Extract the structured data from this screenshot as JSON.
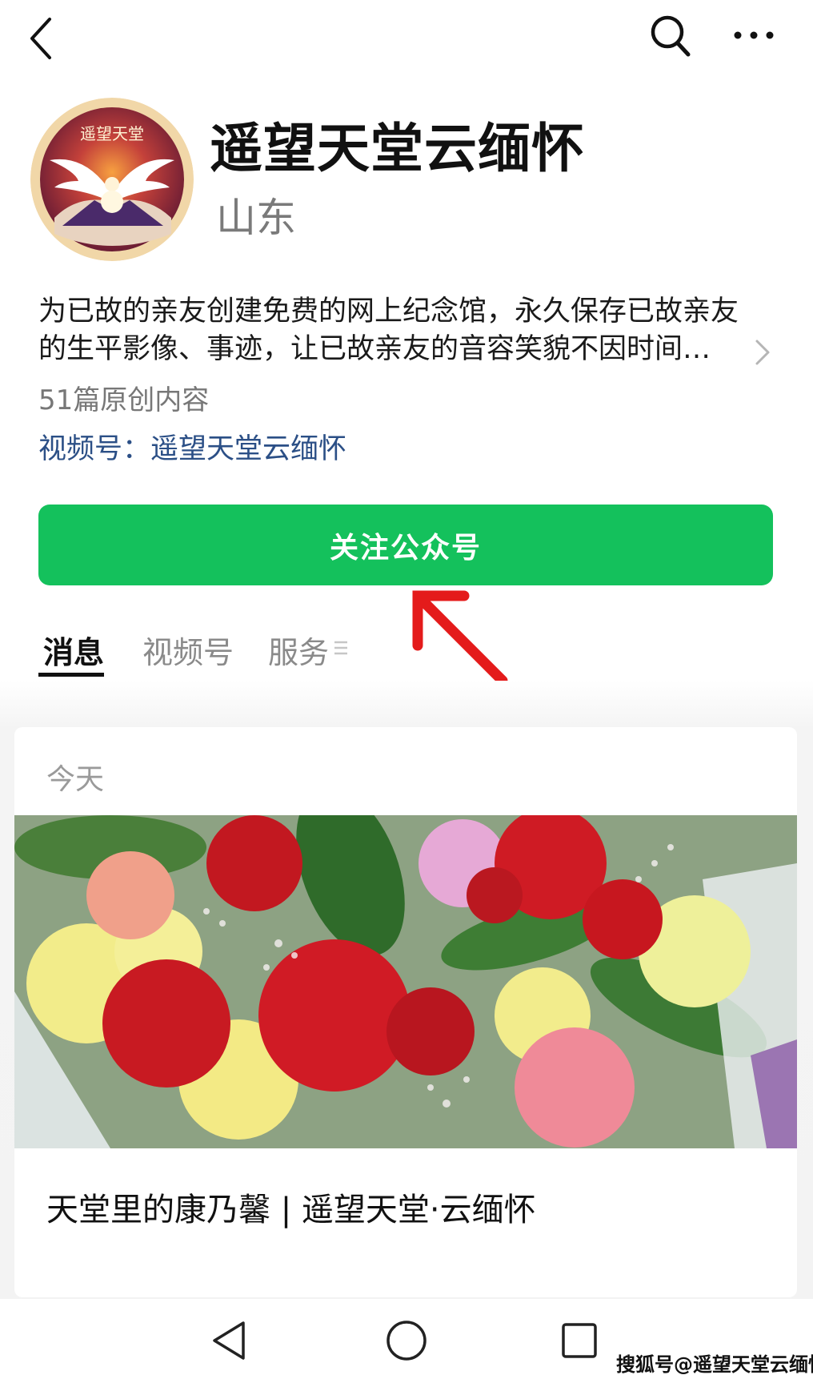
{
  "account": {
    "name": "遥望天堂云缅怀",
    "region": "山东",
    "avatar_text": "遥望天堂",
    "description_line1": "为已故的亲友创建免费的网上纪念馆，永久保存已故亲友",
    "description_line2": "的生平影像、事迹，让已故亲友的音容笑貌不因时间…",
    "original_count": "51篇原创内容",
    "channel": "视频号：遥望天堂云缅怀"
  },
  "follow_button": {
    "label": "关注公众号",
    "color": "#14c15c"
  },
  "tabs": [
    {
      "label": "消息",
      "active": true
    },
    {
      "label": "视频号",
      "active": false
    },
    {
      "label": "服务",
      "active": false
    }
  ],
  "feed": {
    "date_label": "今天",
    "article_title": "天堂里的康乃馨 | 遥望天堂·云缅怀"
  },
  "footer": {
    "watermark": "搜狐号@遥望天堂云缅怀"
  },
  "icons": [
    "back-icon",
    "search-icon",
    "more-icon",
    "chevron-right-icon",
    "menu-icon",
    "nav-back-icon",
    "nav-home-icon",
    "nav-recent-icon"
  ],
  "colors": {
    "accent": "#14c15c",
    "link": "#2b4f86",
    "arrow": "#e41b1b"
  }
}
